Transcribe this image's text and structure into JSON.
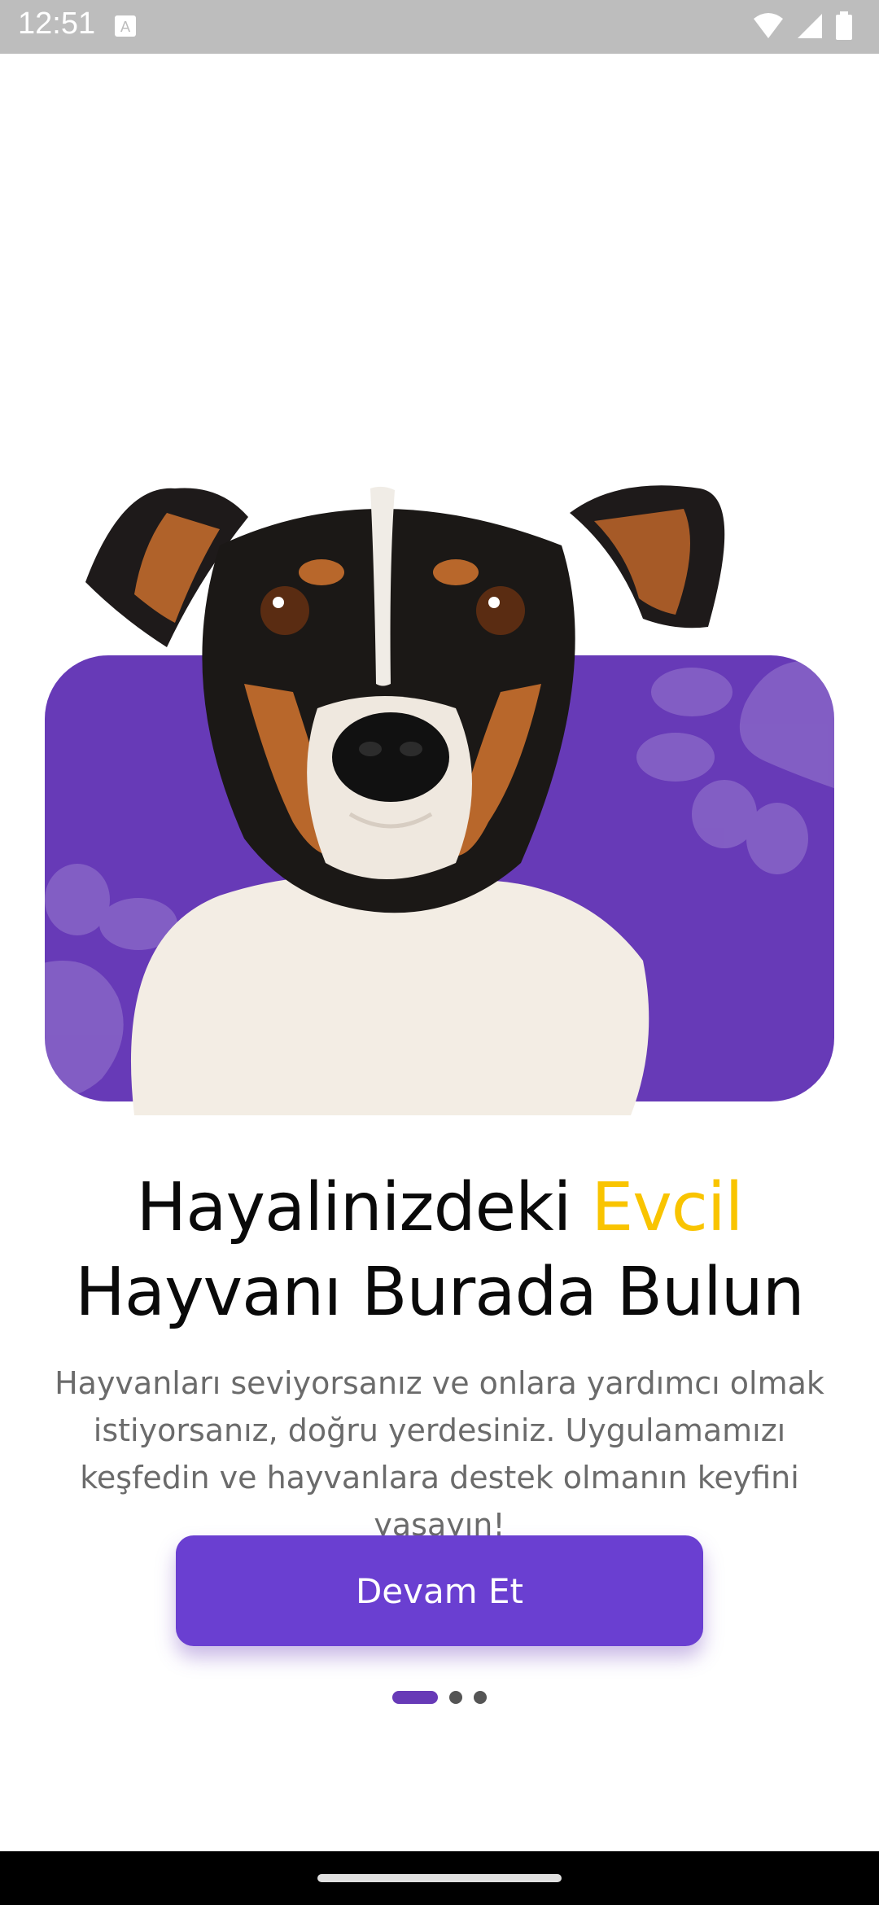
{
  "status_bar": {
    "time": "12:51",
    "icons": [
      "accessibility-icon",
      "wifi-icon",
      "signal-icon",
      "battery-icon"
    ]
  },
  "hero": {
    "image": "dog-photo",
    "card_color": "#673ab7"
  },
  "headline": {
    "line1_part1": "Hayalinizdeki ",
    "line1_accent": "Evcil",
    "line2": "Hayvanı Burada Bulun",
    "accent_color": "#f9c400"
  },
  "subtitle": "Hayvanları seviyorsanız ve onlara yardımcı olmak istiyorsanız, doğru yerdesiniz. Uygulamamızı keşfedin ve hayvanlara destek olmanın keyfini yaşayın!",
  "cta": {
    "label": "Devam Et"
  },
  "pager": {
    "total": 3,
    "active_index": 0
  },
  "colors": {
    "primary": "#673ab7",
    "button": "#6a3fd1",
    "accent": "#f9c400"
  }
}
